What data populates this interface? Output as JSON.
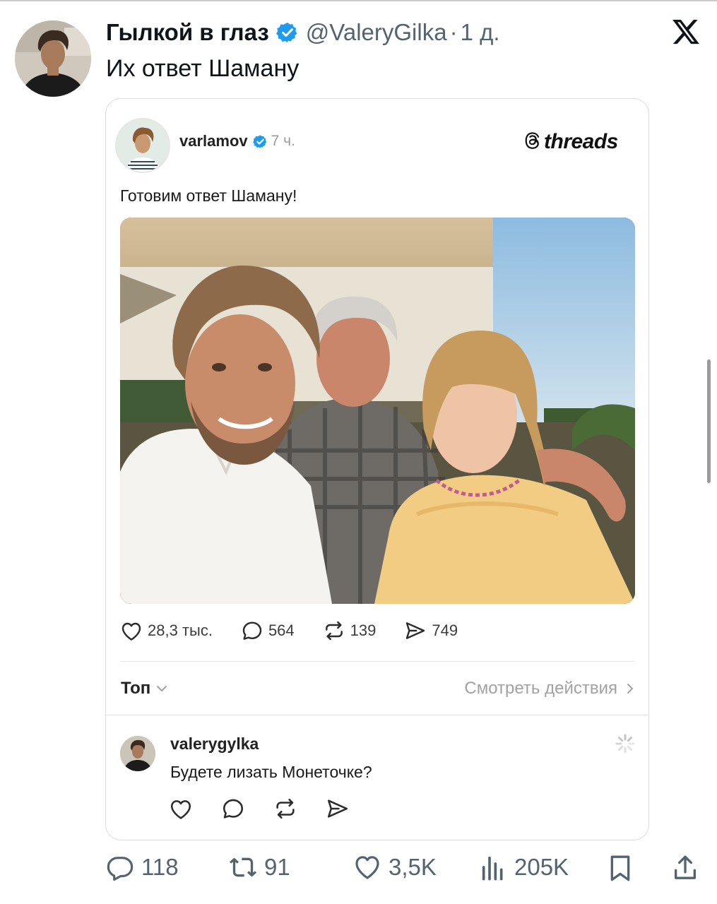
{
  "tweet": {
    "author_name": "Гылкой в глаз",
    "handle": "@ValeryGilka",
    "separator": "·",
    "time": "1 д.",
    "text": "Их ответ Шаману",
    "avatar_icon": "author-avatar",
    "platform_icon": "x-logo-icon"
  },
  "threads_post": {
    "username": "varlamov",
    "time": "7 ч.",
    "brand": "threads",
    "text": "Готовим ответ Шаману!",
    "photo": "selfie-photo",
    "stats": {
      "likes": "28,3 тыс.",
      "replies": "564",
      "reposts": "139",
      "shares": "749"
    },
    "sort_label": "Топ",
    "view_actions_label": "Смотреть действия",
    "reply": {
      "username": "valerygylka",
      "text": "Будете лизать Монеточке?"
    }
  },
  "tweet_actions": {
    "replies": "118",
    "retweets": "91",
    "likes": "3,5K",
    "views": "205K"
  },
  "colors": {
    "verified_blue": "#1d9bf0",
    "muted_text": "#536471",
    "threads_muted": "#a2a2a2"
  }
}
